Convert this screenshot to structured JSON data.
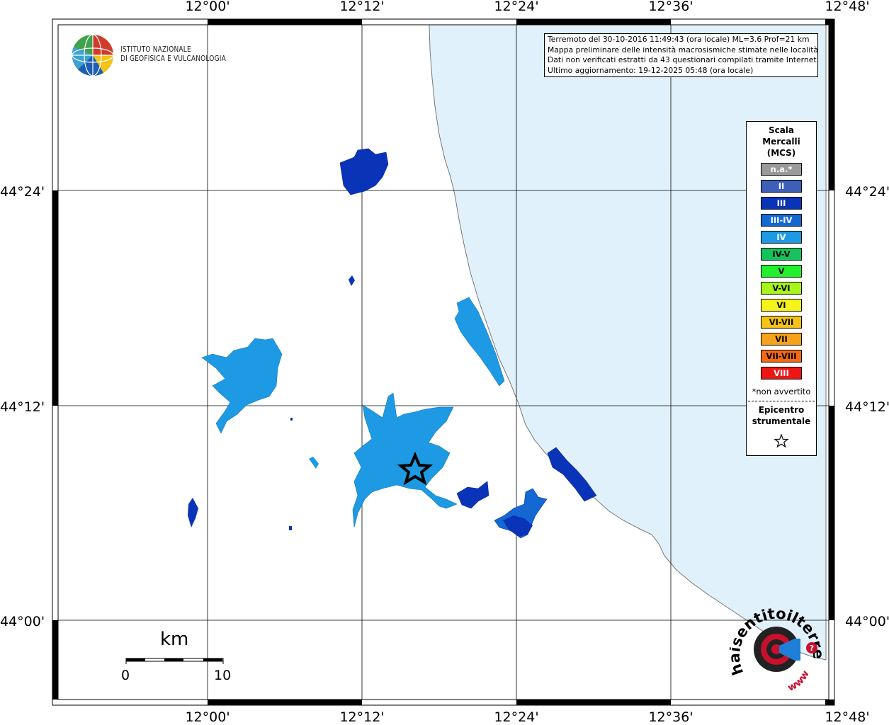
{
  "header": {
    "lines": [
      "Terremoto del 30-10-2016 11:49:43 (ora locale) ML=3.6 Prof=21 km",
      "Mappa preliminare delle intensità macrosismiche stimate nelle località",
      "Dati non verificati estratti da 43 questionari compilati tramite Internet.",
      "Ultimo aggiornamento: 19-12-2025 05:48 (ora locale)"
    ]
  },
  "institute": {
    "line1": "ISTITUTO NAZIONALE",
    "line2": "DI GEOFISICA E VULCANOLOGIA"
  },
  "axes": {
    "longitude_labels": [
      "12°00'",
      "12°12'",
      "12°24'",
      "12°36'",
      "12°48'"
    ],
    "latitude_labels": [
      "44°24'",
      "44°12'",
      "44°00'"
    ]
  },
  "legend": {
    "title_lines": [
      "Scala",
      "Mercalli",
      "(MCS)"
    ],
    "items": [
      {
        "label": "n.a.*",
        "color": "#9a9a9a",
        "text_color": "#ffffff"
      },
      {
        "label": "II",
        "color": "#3d5fb8",
        "text_color": "#ffffff"
      },
      {
        "label": "III",
        "color": "#0a34b8",
        "text_color": "#ffffff"
      },
      {
        "label": "III-IV",
        "color": "#1368d1",
        "text_color": "#ffffff"
      },
      {
        "label": "IV",
        "color": "#1d9ae3",
        "text_color": "#ffffff"
      },
      {
        "label": "IV-V",
        "color": "#15c35e",
        "text_color": "#000000"
      },
      {
        "label": "V",
        "color": "#22f02c",
        "text_color": "#000000"
      },
      {
        "label": "V-VI",
        "color": "#a6f51b",
        "text_color": "#000000"
      },
      {
        "label": "VI",
        "color": "#f6f41a",
        "text_color": "#000000"
      },
      {
        "label": "VI-VII",
        "color": "#f5c316",
        "text_color": "#000000"
      },
      {
        "label": "VII",
        "color": "#f7a21a",
        "text_color": "#000000"
      },
      {
        "label": "VII-VIII",
        "color": "#f46a15",
        "text_color": "#000000"
      },
      {
        "label": "VIII",
        "color": "#ee1515",
        "text_color": "#ffffff"
      }
    ],
    "note": "*non avvertito",
    "epicenter_lines": [
      "Epicentro",
      "strumentale"
    ]
  },
  "scale_bar": {
    "unit": "km",
    "start": "0",
    "end": "10"
  },
  "logo2": {
    "arc_text": "haisentitoilterremoto.it",
    "sub_text": "www."
  },
  "colors": {
    "sea": "#e1f1fc",
    "intensity_III": "#0a34b8",
    "intensity_III_IV": "#1368d1",
    "intensity_IV": "#1d9ae3"
  }
}
